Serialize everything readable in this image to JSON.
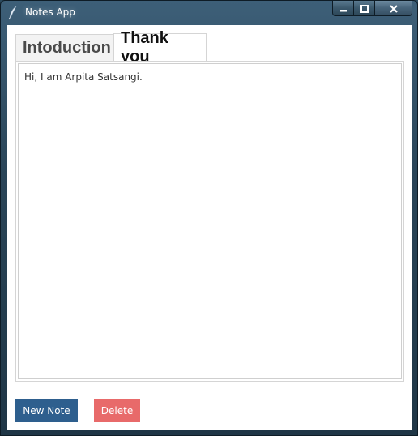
{
  "window": {
    "title": "Notes App",
    "icon": "feather-pen-icon",
    "controls": {
      "minimize": "minimize-icon",
      "maximize": "maximize-icon",
      "close": "close-icon"
    }
  },
  "tabs": [
    {
      "label": "Intoduction",
      "selected": false
    },
    {
      "label": "Thank you",
      "selected": true
    }
  ],
  "note": {
    "content": "Hi, I am Arpita Satsangi."
  },
  "buttons": {
    "new_note": "New Note",
    "delete": "Delete"
  },
  "colors": {
    "new_note_bg": "#2e5f8e",
    "delete_bg": "#e86a6a",
    "titlebar": "#2a4558"
  }
}
